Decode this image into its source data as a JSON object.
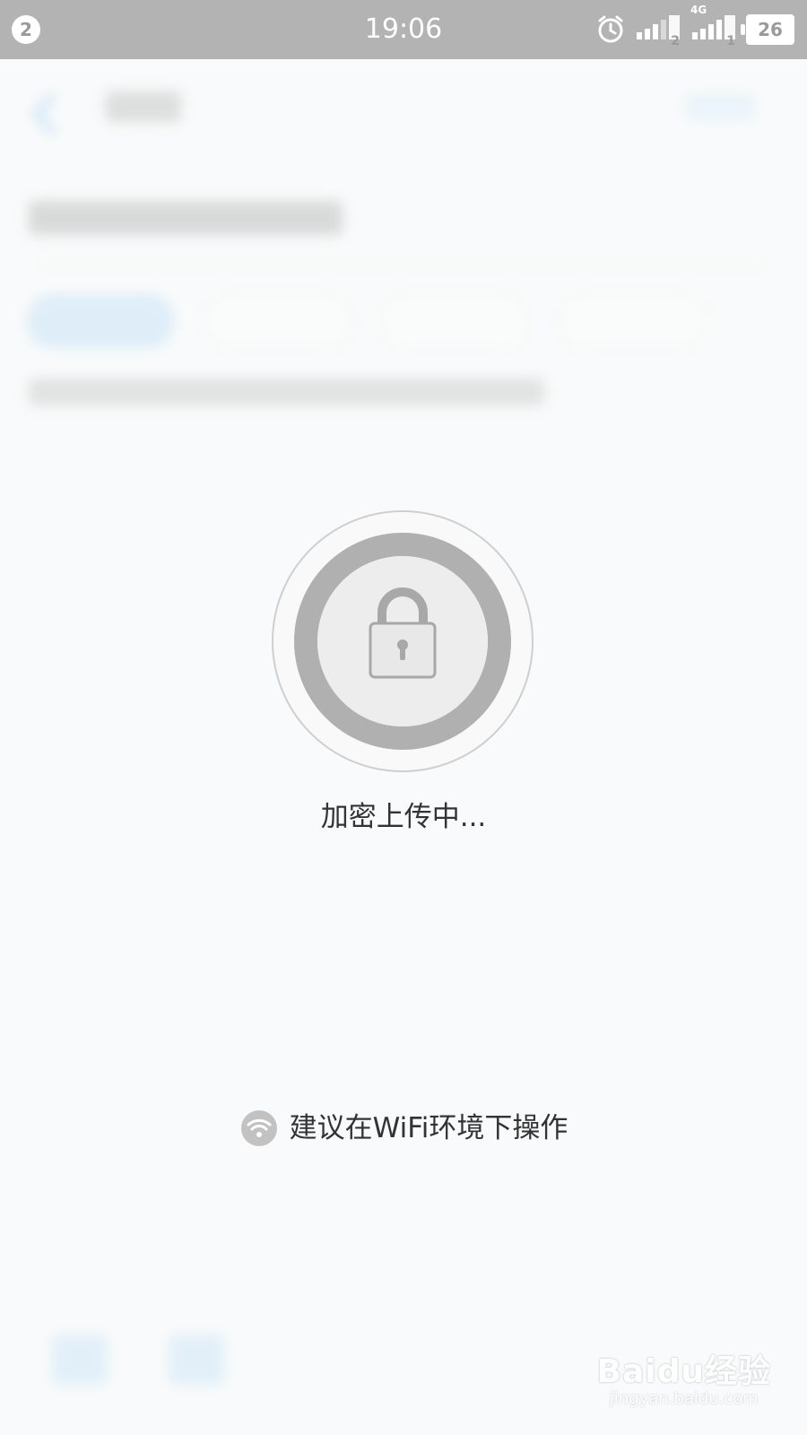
{
  "status_bar": {
    "notification_count": "2",
    "time": "19:06",
    "network_label": "4G",
    "sim1": "2",
    "sim2": "1",
    "battery": "26"
  },
  "upload_overlay": {
    "status_text": "加密上传中...",
    "wifi_tip": "建议在WiFi环境下操作",
    "icon": "lock-icon"
  },
  "watermark": {
    "logo": "Baidu经验",
    "url": "jingyan.baidu.com"
  },
  "colors": {
    "accent": "#8ec5f0",
    "ring": "#b0b0b0",
    "status_bar": "#b3b3b3"
  }
}
